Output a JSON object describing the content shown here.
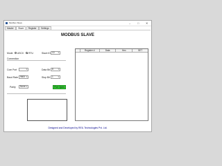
{
  "window": {
    "title": "Modbus Slave",
    "controls": {
      "minimize": "–",
      "maximize": "□",
      "close": "✕"
    }
  },
  "tabs": [
    "Master",
    "Slave",
    "Register",
    "Settings"
  ],
  "active_tab": "Slave",
  "heading": "MODBUS SLAVE",
  "mode": {
    "label": "Mode",
    "options": [
      "ASCII",
      "RTU"
    ],
    "selected": "RTU",
    "slave_id_label": "Slave ID",
    "slave_id_value": "10"
  },
  "connection": {
    "label": "Connection",
    "com_port_label": "Com Port",
    "com_port_value": "",
    "data_bit_label": "Data Bit",
    "data_bit_value": "8",
    "baud_rate_label": "Baud Rate",
    "baud_rate_value": "9600",
    "stop_bit_label": "Stop Bit",
    "stop_bit_value": "1",
    "parity_label": "Parity",
    "parity_value": "None",
    "port_open_label": "Port Open"
  },
  "register_table": {
    "columns": [
      "Register #",
      "Data",
      "Hex",
      "SET"
    ]
  },
  "footer": "Designed and Developed by REIL Technologies Pvt. Ltd.",
  "colors": {
    "port_open_bg": "#33cc33",
    "footer_text": "#00008b"
  }
}
